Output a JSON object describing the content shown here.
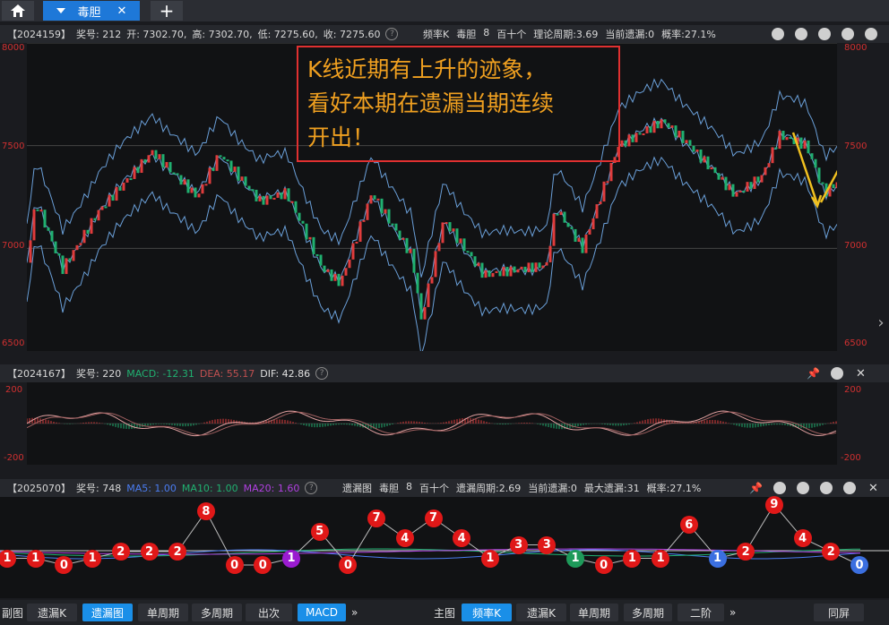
{
  "tabs": {
    "home_icon": "home-icon",
    "active_tab": "毒胆",
    "add_icon": "plus-icon"
  },
  "top_header": {
    "period": "【2024159】",
    "award": "奖号: 212",
    "open": "开: 7302.70,",
    "high": "高: 7302.70,",
    "low": "低: 7275.60,",
    "close": "收: 7275.60",
    "right_items": [
      "频率K",
      "毒胆",
      "8",
      "百十个",
      "理论周期:3.69",
      "当前遗漏:0",
      "概率:27.1%"
    ]
  },
  "main_axis": {
    "left": [
      "8000",
      "7500",
      "7000",
      "6500"
    ],
    "right": [
      "8000",
      "7500",
      "7000",
      "6500"
    ]
  },
  "annotation": {
    "line1": "K线近期有上升的迹象，",
    "line2": "看好本期在遗漏当期连续",
    "line3": "开出！"
  },
  "macd_header": {
    "period": "【2024167】",
    "award": "奖号: 220",
    "macd": "MACD: -12.31",
    "dea": "DEA: 55.17",
    "dif": "DIF: 42.86"
  },
  "macd_axis": {
    "top": "200",
    "bottom": "-200"
  },
  "miss_header": {
    "period": "【2025070】",
    "award": "奖号: 748",
    "ma5": "MA5: 1.00",
    "ma10": "MA10: 1.00",
    "ma20": "MA20: 1.60",
    "right_items": [
      "遗漏图",
      "毒胆",
      "8",
      "百十个",
      "遗漏周期:2.69",
      "当前遗漏:0",
      "最大遗漏:31",
      "概率:27.1%"
    ]
  },
  "miss_balls": [
    {
      "v": "1",
      "c": "red"
    },
    {
      "v": "1",
      "c": "red"
    },
    {
      "v": "0",
      "c": "red"
    },
    {
      "v": "1",
      "c": "red"
    },
    {
      "v": "2",
      "c": "red"
    },
    {
      "v": "2",
      "c": "red"
    },
    {
      "v": "2",
      "c": "red"
    },
    {
      "v": "8",
      "c": "red"
    },
    {
      "v": "0",
      "c": "red"
    },
    {
      "v": "0",
      "c": "red"
    },
    {
      "v": "1",
      "c": "purple"
    },
    {
      "v": "5",
      "c": "red"
    },
    {
      "v": "0",
      "c": "red"
    },
    {
      "v": "7",
      "c": "red"
    },
    {
      "v": "4",
      "c": "red"
    },
    {
      "v": "7",
      "c": "red"
    },
    {
      "v": "4",
      "c": "red"
    },
    {
      "v": "1",
      "c": "red"
    },
    {
      "v": "3",
      "c": "red"
    },
    {
      "v": "3",
      "c": "red"
    },
    {
      "v": "1",
      "c": "green"
    },
    {
      "v": "0",
      "c": "red"
    },
    {
      "v": "1",
      "c": "red"
    },
    {
      "v": "1",
      "c": "red"
    },
    {
      "v": "6",
      "c": "red"
    },
    {
      "v": "1",
      "c": "blue"
    },
    {
      "v": "2",
      "c": "red"
    },
    {
      "v": "9",
      "c": "red"
    },
    {
      "v": "4",
      "c": "red"
    },
    {
      "v": "2",
      "c": "red"
    },
    {
      "v": "0",
      "c": "blue"
    }
  ],
  "bottom_bar": {
    "left_label": "副图",
    "left_buttons": [
      "遗漏K",
      "遗漏图",
      "单周期",
      "多周期",
      "出次",
      "MACD"
    ],
    "left_active": "遗漏图",
    "left_active2": "MACD",
    "more": "»",
    "main_label": "主图",
    "right_buttons": [
      "频率K",
      "遗漏K",
      "单周期",
      "多周期",
      "二阶"
    ],
    "right_active": "频率K",
    "more2": "»",
    "split": "同屏"
  },
  "colors": {
    "up": "#e03c3c",
    "down": "#20b070",
    "boll": "#6a9fd8",
    "accent": "#1a8fe8",
    "annot_text": "#f0a020",
    "annot_border": "#e03030",
    "arrow": "#f0c020"
  }
}
